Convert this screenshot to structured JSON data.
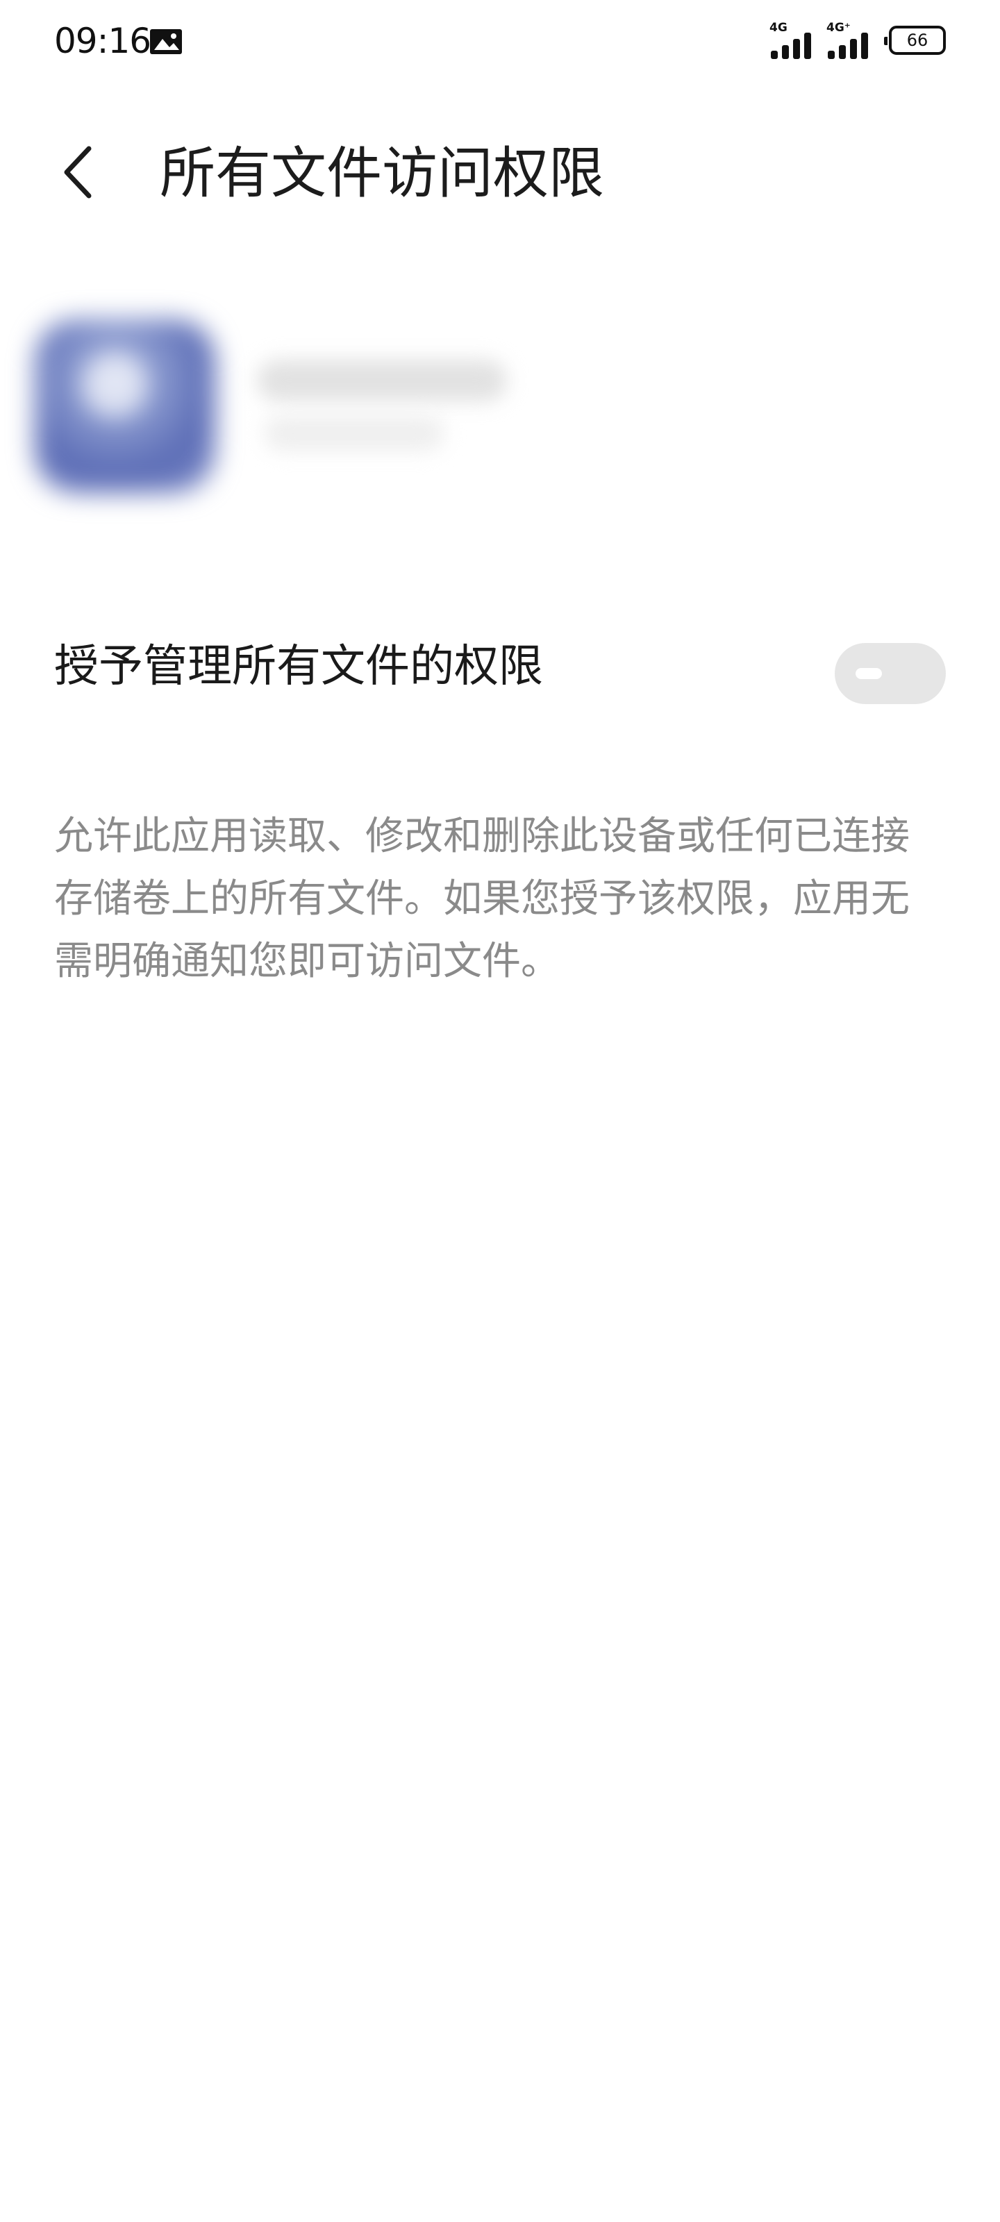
{
  "status_bar": {
    "time": "09:16",
    "gallery_icon": "image-notification-icon",
    "signal_1": {
      "label": "4G",
      "icon": "cell-signal-icon"
    },
    "signal_2": {
      "label": "4G⁺",
      "icon": "cell-signal-icon"
    },
    "battery_level": "66"
  },
  "header": {
    "back_icon": "chevron-left-icon",
    "title": "所有文件访问权限"
  },
  "app_info": {
    "icon": "app-icon"
  },
  "permission": {
    "label": "授予管理所有文件的权限",
    "enabled": false
  },
  "description": {
    "text": "允许此应用读取、修改和删除此设备或任何已连接存储卷上的所有文件。如果您授予该权限，应用无需明确通知您即可访问文件。"
  },
  "colors": {
    "background": "#ffffff",
    "title_text": "#1c1c1c",
    "description_text": "#8a8a8a",
    "toggle_off_track": "#e6e6e6"
  }
}
